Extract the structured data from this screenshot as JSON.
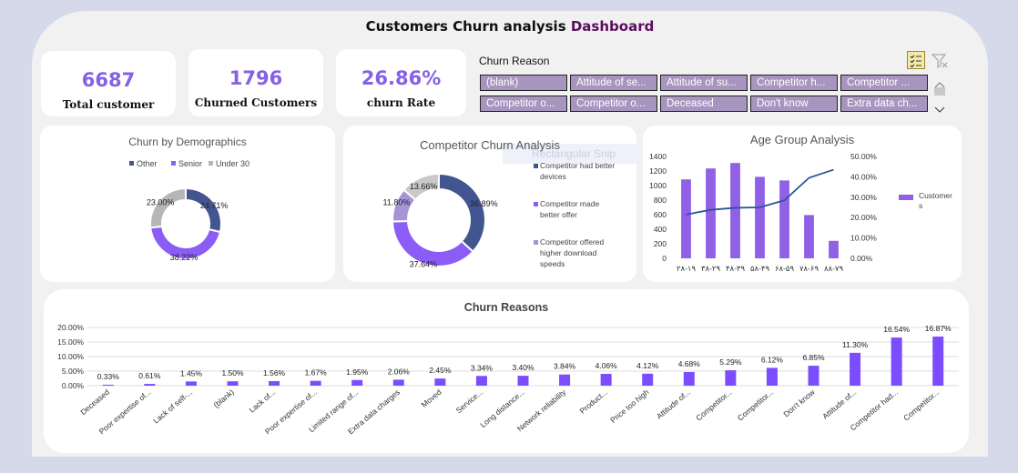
{
  "title_main": "Customers Churn analysis ",
  "title_accent": "Dashboard",
  "kpis": [
    {
      "value": "6687",
      "label": "Total customer"
    },
    {
      "value": "1796",
      "label": "Churned Customers"
    },
    {
      "value": "26.86%",
      "label": "churn Rate"
    }
  ],
  "slicer": {
    "title": "Churn Reason",
    "items": [
      "(blank)",
      "Attitude of se...",
      "Attitude of su...",
      "Competitor h...",
      "Competitor ...",
      "Competitor o...",
      "Competitor o...",
      "Deceased",
      "Don't know",
      "Extra data ch..."
    ],
    "icons": [
      "multi-select-icon",
      "clear-filter-icon",
      "scroll-up-icon",
      "scroll-down-icon"
    ]
  },
  "ghost_label": "Rectangular Snip",
  "colors": {
    "dark_blue": "#435590",
    "purple": "#8b5cf6",
    "lavender": "#a594d6",
    "grey": "#b6b6b6",
    "line": "#2f5597"
  },
  "chart_data": [
    {
      "type": "pie",
      "title": "Churn by Demographics",
      "legend": [
        "Other",
        "Senior",
        "Under 30"
      ],
      "legend_position": "top",
      "slices": [
        {
          "name": "Other",
          "value": 38.22,
          "label": "38.22%",
          "color": "#8b5cf6"
        },
        {
          "name": "Senior",
          "value": 24.71,
          "label": "24.71%",
          "color": "#435590"
        },
        {
          "name": "Under 30",
          "value": 23.0,
          "label": "23.00%",
          "color": "#b6b6b6"
        }
      ]
    },
    {
      "type": "pie",
      "title": "Competitor Churn Analysis",
      "legend_position": "right",
      "slices": [
        {
          "name": "Competitor had better devices",
          "value": 36.89,
          "label": "36.89%",
          "color": "#435590"
        },
        {
          "name": "Competitor made better offer",
          "value": 37.64,
          "label": "37.64%",
          "color": "#8b5cf6"
        },
        {
          "name": "Competitor offered higher download speeds",
          "value": 11.8,
          "label": "11.80%",
          "color": "#a594d6"
        },
        {
          "name": "",
          "value": 13.66,
          "label": "13.66%",
          "color": "#c9c9c9"
        }
      ]
    },
    {
      "type": "bar",
      "title": "Age Group Analysis",
      "categories": [
        "۲۸-۱۹",
        "۳۸-۲۹",
        "۴۸-۳۹",
        "۵۸-۴۹",
        "۶۸-۵۹",
        "۷۸-۶۹",
        "۸۸-۷۹"
      ],
      "series": [
        {
          "name": "Customers",
          "values": [
            1085,
            1235,
            1310,
            1120,
            1070,
            595,
            240
          ]
        },
        {
          "name": "",
          "type": "line",
          "axis": "secondary",
          "values": [
            21.5,
            23.8,
            24.8,
            25.0,
            28.5,
            39.5,
            43.5
          ]
        }
      ],
      "ylim": [
        0,
        1400
      ],
      "yticks": [
        "0",
        "200",
        "400",
        "600",
        "800",
        "1000",
        "1200",
        "1400"
      ],
      "y2lim": [
        0,
        50
      ],
      "y2ticks": [
        "0.00%",
        "10.00%",
        "20.00%",
        "30.00%",
        "40.00%",
        "50.00%"
      ],
      "legend_position": "right",
      "grid": false
    },
    {
      "type": "bar",
      "title": "Churn Reasons",
      "categories": [
        "Deceased",
        "Poor expertise of...",
        "Lack of self-...",
        "(blank)",
        "Lack of...",
        "Poor expertise of...",
        "Limited range of...",
        "Extra data charges",
        "Moved",
        "Service...",
        "Long distance...",
        "Network reliability",
        "Product...",
        "Price too high",
        "Attitude of...",
        "Competitor...",
        "Competitor...",
        "Don't know",
        "Attitude of...",
        "Competitor had...",
        "Competitor..."
      ],
      "values": [
        0.33,
        0.61,
        1.45,
        1.5,
        1.56,
        1.67,
        1.95,
        2.06,
        2.45,
        3.34,
        3.4,
        3.84,
        4.06,
        4.12,
        4.68,
        5.29,
        6.12,
        6.85,
        11.3,
        16.54,
        16.87
      ],
      "labels": [
        "0.33%",
        "0.61%",
        "1.45%",
        "1.50%",
        "1.56%",
        "1.67%",
        "1.95%",
        "2.06%",
        "2.45%",
        "3.34%",
        "3.40%",
        "3.84%",
        "4.06%",
        "4.12%",
        "4.68%",
        "5.29%",
        "6.12%",
        "6.85%",
        "11.30%",
        "16.54%",
        "16.87%"
      ],
      "ylim": [
        0,
        20
      ],
      "yticks": [
        "0.00%",
        "5.00%",
        "10.00%",
        "15.00%",
        "20.00%"
      ],
      "grid": true
    }
  ]
}
